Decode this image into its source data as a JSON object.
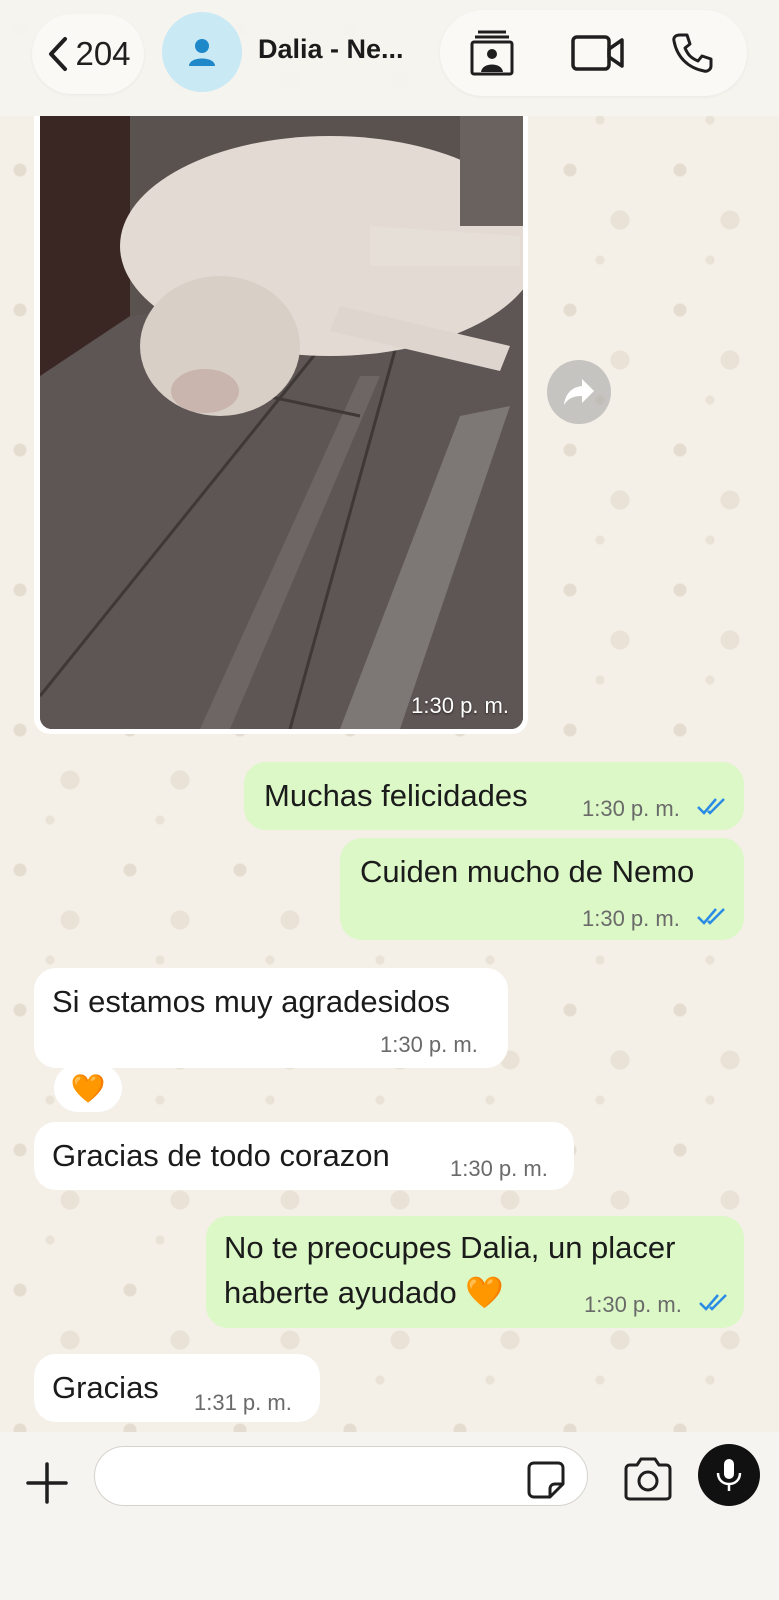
{
  "header": {
    "back_count": "204",
    "contact_name": "Dalia - Ne...",
    "icons": [
      "chevron-left-icon",
      "person-icon",
      "contact-card-icon",
      "video-call-icon",
      "phone-icon"
    ]
  },
  "messages": {
    "photo": {
      "time": "1:30 p. m."
    },
    "m1": {
      "text": "Muchas felicidades",
      "time": "1:30 p. m."
    },
    "m2": {
      "text": "Cuiden mucho de Nemo",
      "time": "1:30 p. m."
    },
    "m3": {
      "text": "Si estamos muy agradesidos",
      "time": "1:30 p. m.",
      "reaction": "🧡"
    },
    "m4": {
      "text": "Gracias de todo corazon",
      "time": "1:30 p. m."
    },
    "m5": {
      "line1": "No te preocupes Dalia, un placer",
      "line2": "haberte ayudado 🧡",
      "time": "1:30 p. m."
    },
    "m6": {
      "text": "Gracias",
      "time": "1:31 p. m."
    }
  },
  "composer": {
    "placeholder": "",
    "icons": [
      "plus-icon",
      "sticker-icon",
      "camera-icon",
      "microphone-icon"
    ]
  },
  "colors": {
    "outgoing_bubble": "#dbf8c6",
    "incoming_bubble": "#ffffff",
    "read_ticks": "#2a8be6",
    "avatar_bg": "#c9e9f5",
    "avatar_fg": "#1e88c8"
  }
}
